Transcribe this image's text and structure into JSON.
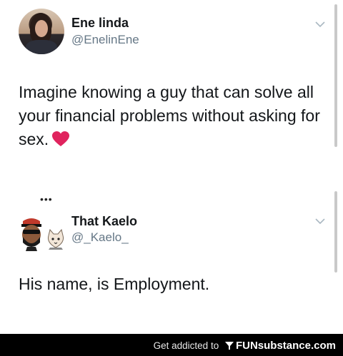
{
  "tweets": [
    {
      "author_name": "Ene linda",
      "author_handle": "@EnelinEne",
      "text": "Imagine knowing a guy that can solve all your financial problems without asking for sex.",
      "emoji": "red-heart-icon"
    },
    {
      "author_name": "That Kaelo",
      "author_handle": "@_Kaelo_",
      "text": "His name, is Employment."
    }
  ],
  "footer": {
    "prefix": "Get addicted to ",
    "brand": "FUNsubstance.com"
  },
  "colors": {
    "name": "#14171a",
    "handle": "#657786",
    "heart": "#e0245e",
    "footer_bg": "#000000"
  }
}
